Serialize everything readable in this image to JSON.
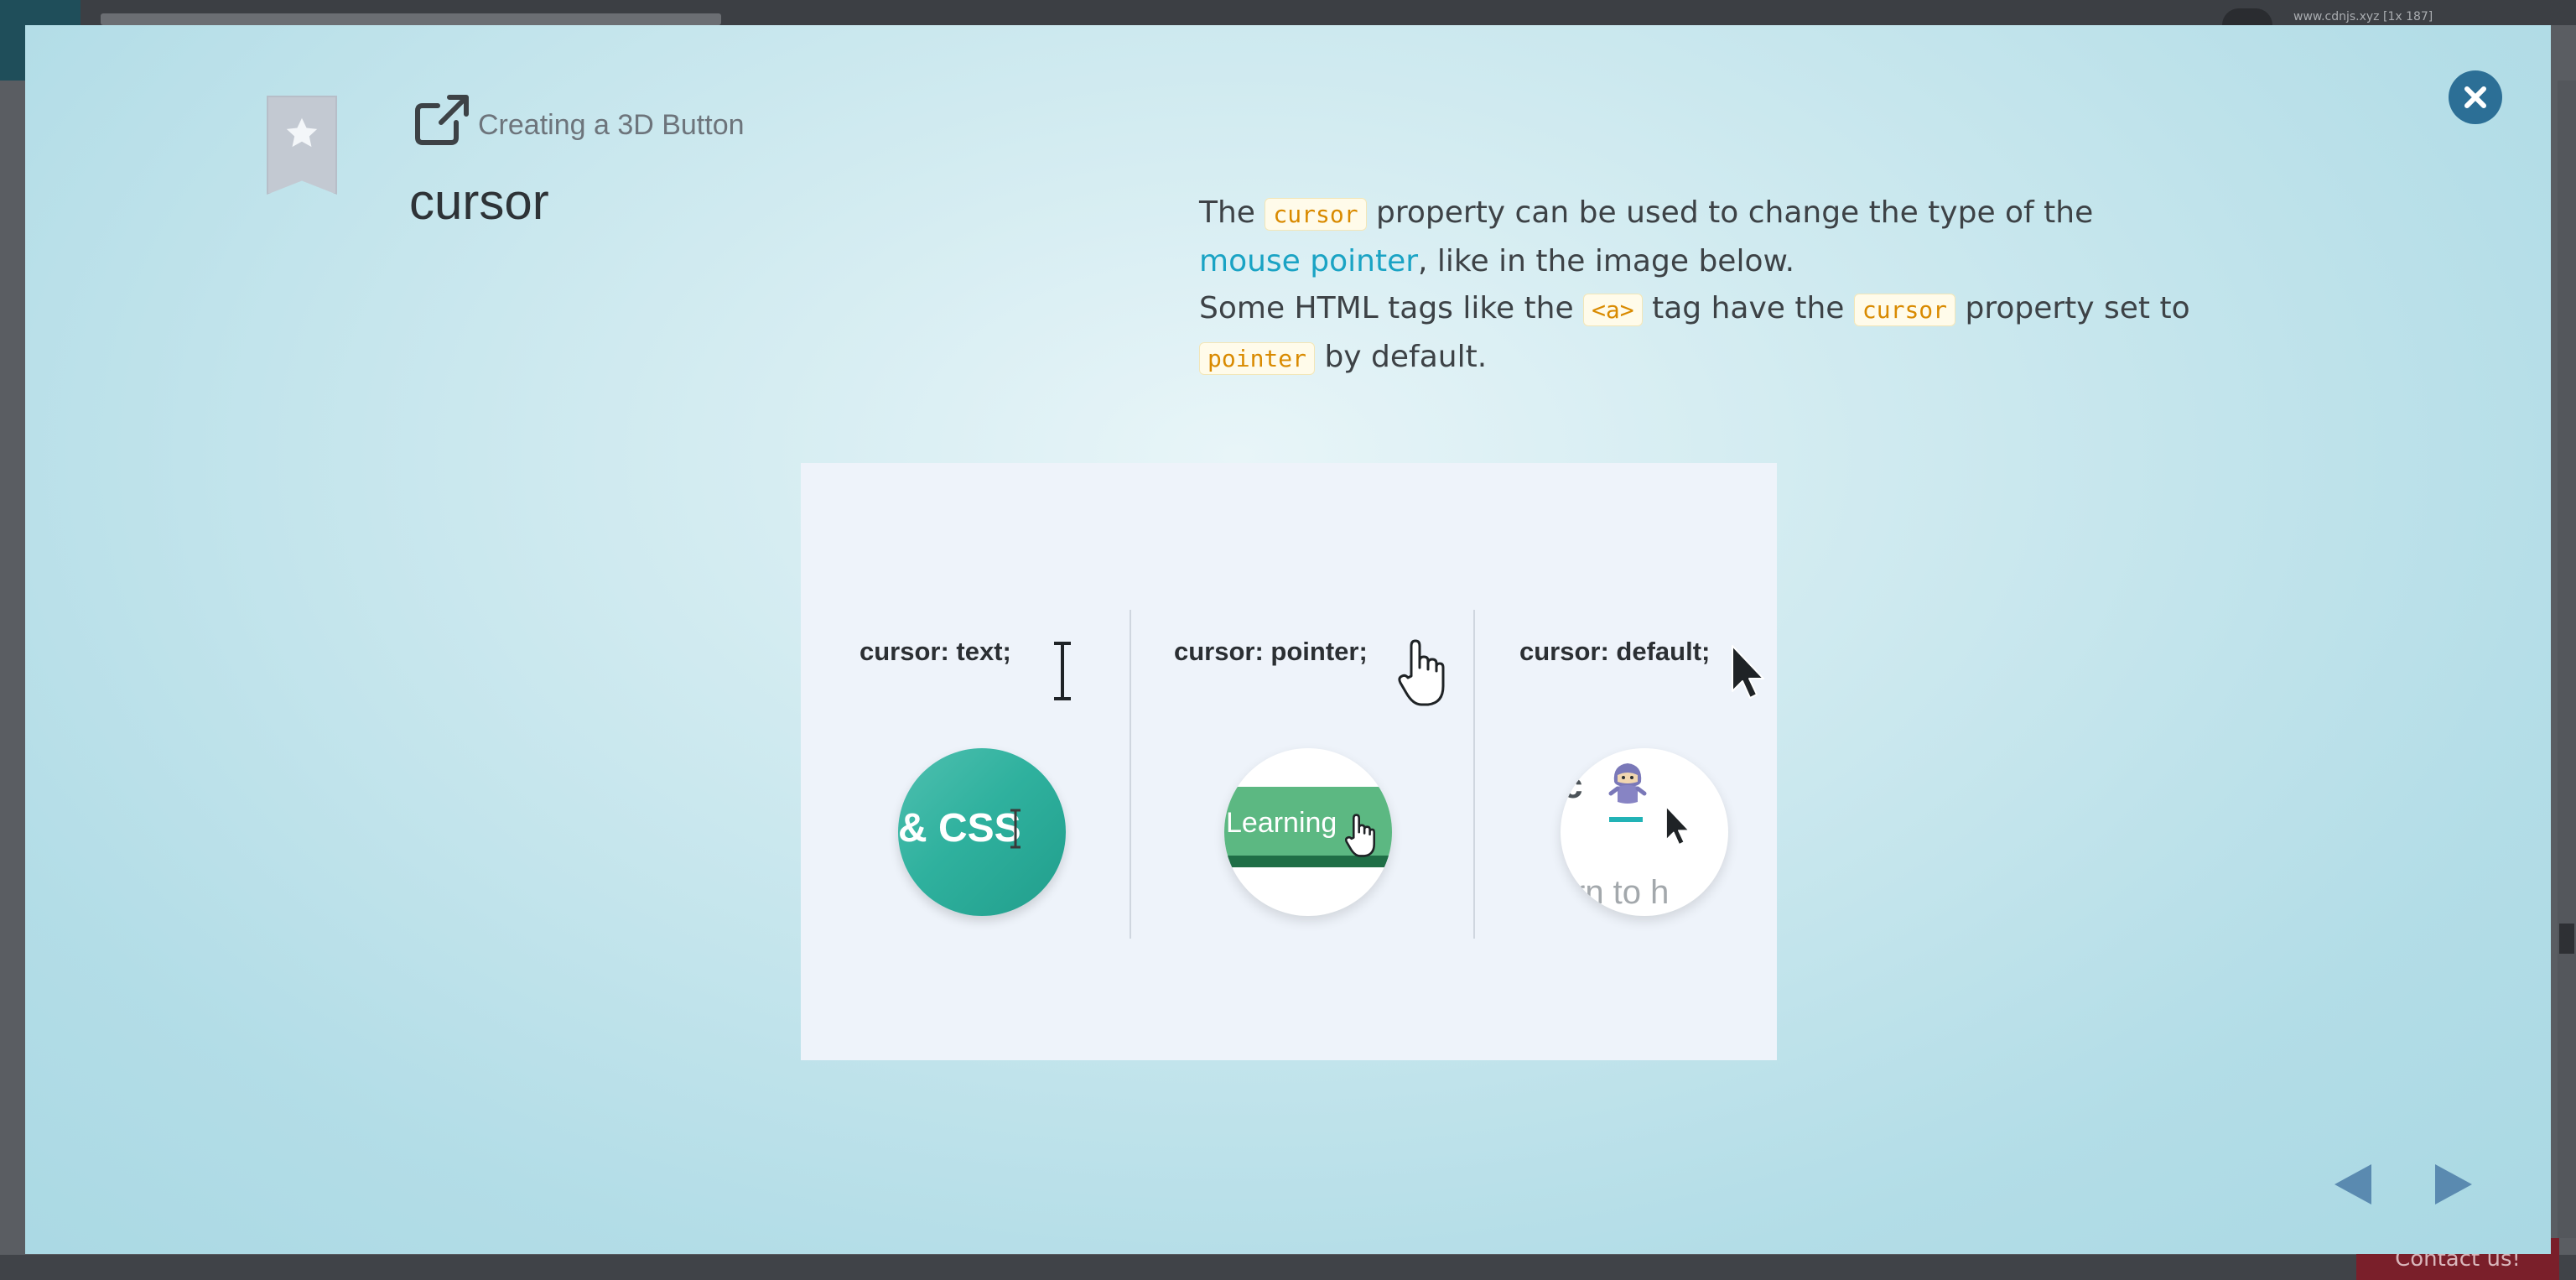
{
  "background": {
    "url_text": "www.cdnjs.xyz [1x 187]",
    "contact_label": "Contact us!"
  },
  "modal": {
    "lesson_title": "Creating a 3D Button",
    "page_title": "cursor",
    "description": {
      "line1_pre": "The ",
      "line1_code": "cursor",
      "line1_post": " property can be used to change the type of the",
      "link_text": "mouse pointer",
      "line2_post": ", like in the image below.",
      "line3_pre": "Some HTML tags like the ",
      "line3_code1": "<a>",
      "line3_mid": " tag have the ",
      "line3_code2": "cursor",
      "line3_post": " property set to",
      "line4_code": "pointer",
      "line4_post": " by default."
    },
    "illustration": {
      "cursor_text_label": "cursor: text;",
      "cursor_pointer_label": "cursor: pointer;",
      "cursor_default_label": "cursor: default;",
      "circle1_text": "& CSS",
      "circle2_text": "Learning",
      "circle3_fragment": "c",
      "circle3_text": "rn to h"
    },
    "icons": {
      "bookmark": "star-icon",
      "external_link": "external-link-icon",
      "close": "close-icon",
      "prev": "arrow-left-icon",
      "next": "arrow-right-icon"
    },
    "colors": {
      "accent_blue": "#2c6f96",
      "link": "#1aa3c4",
      "code": "#d98a00",
      "teal": "#2fb19e",
      "green": "#5cb882"
    }
  }
}
